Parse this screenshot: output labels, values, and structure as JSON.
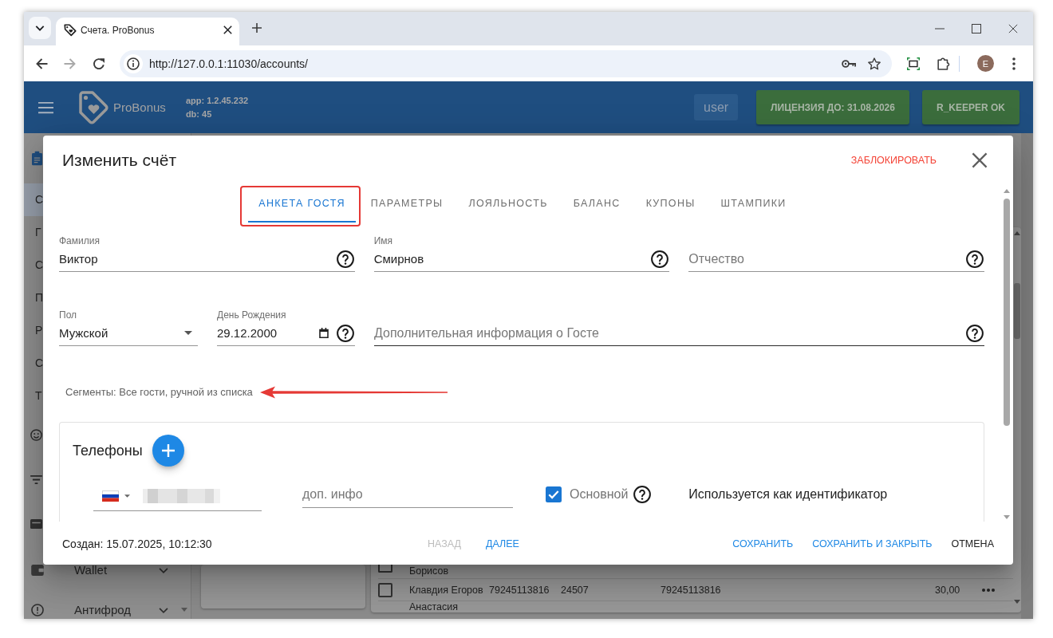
{
  "browser": {
    "tabs": [
      {
        "title": "Счета. ProBonus",
        "selected": true
      }
    ],
    "url": "http://127.0.0.1:11030/accounts/",
    "profile_initial": "E"
  },
  "header": {
    "brand": "ProBonus",
    "version_lines": [
      "app: 1.2.45.232",
      "db: 45"
    ],
    "user": "user",
    "status_buttons": [
      "ЛИЦЕНЗИЯ ДО: 31.08.2026",
      "R_KEEPER OK"
    ]
  },
  "sidebar": {
    "items": [
      {
        "label": "С",
        "selected": true
      },
      {
        "label": "Г",
        "selected": false
      },
      {
        "label": "С",
        "selected": false
      },
      {
        "label": "П",
        "selected": false
      },
      {
        "label": "Р",
        "selected": false
      },
      {
        "label": "С",
        "selected": false
      },
      {
        "label": "Т",
        "selected": false
      }
    ],
    "groups": [
      {
        "label": "Wallet",
        "expanded": false
      },
      {
        "label": "Антифрод",
        "expanded": false
      }
    ]
  },
  "table": {
    "rows": [
      {
        "kind": "cut",
        "checked": false,
        "cells": [
          "Борисов"
        ]
      },
      {
        "kind": "full",
        "checked": false,
        "cells": [
          "Клавдия Егоров",
          "79245113816",
          "24507",
          "79245113816",
          "30,00"
        ]
      }
    ],
    "cut_row": "Анастасия"
  },
  "dialog": {
    "title": "Изменить счёт",
    "block_action": "ЗАБЛОКИРОВАТЬ",
    "tabs": [
      {
        "label": "АНКЕТА ГОСТЯ",
        "selected": true,
        "annotated": true
      },
      {
        "label": "ПАРАМЕТРЫ",
        "selected": false,
        "annotated": false
      },
      {
        "label": "ЛОЯЛЬНОСТЬ",
        "selected": false,
        "annotated": false
      },
      {
        "label": "БАЛАНС",
        "selected": false,
        "annotated": false
      },
      {
        "label": "КУПОНЫ",
        "selected": false,
        "annotated": false
      },
      {
        "label": "ШТАМПИКИ",
        "selected": false,
        "annotated": false
      }
    ],
    "field_rows": [
      [
        {
          "kind": "text",
          "label": "Фамилия",
          "value": "Виктор",
          "help": true
        },
        {
          "kind": "text",
          "label": "Имя",
          "value": "Смирнов",
          "help": true
        },
        {
          "kind": "text",
          "placeholder": "Отчество",
          "help": true
        }
      ],
      [
        {
          "kind": "select",
          "label": "Пол",
          "value": "Мужской",
          "help": false
        },
        {
          "kind": "date",
          "label": "День Рождения",
          "value": "29.12.2000",
          "help": true
        },
        {
          "kind": "textarea",
          "placeholder": "Дополнительная информация о Госте",
          "help": true
        }
      ]
    ],
    "segments": {
      "text": "Сегменты: Все гости, ручной из списка",
      "annotated": true
    },
    "phones": {
      "title": "Телефоны",
      "items": [
        {
          "extra_placeholder": "доп. инфо",
          "primary": true,
          "primary_label": "Основной",
          "note": "Используется как идентификатор"
        }
      ]
    },
    "created": "Создан: 15.07.2025, 10:12:30",
    "nav_buttons": [
      {
        "label": "НАЗАД",
        "disabled": true
      },
      {
        "label": "ДАЛЕЕ",
        "disabled": false
      }
    ],
    "action_buttons": [
      {
        "label": "СОХРАНИТЬ",
        "kind": "primary"
      },
      {
        "label": "СОХРАНИТЬ И ЗАКРЫТЬ",
        "kind": "primary"
      },
      {
        "label": "ОТМЕНА",
        "kind": "plain"
      }
    ]
  }
}
